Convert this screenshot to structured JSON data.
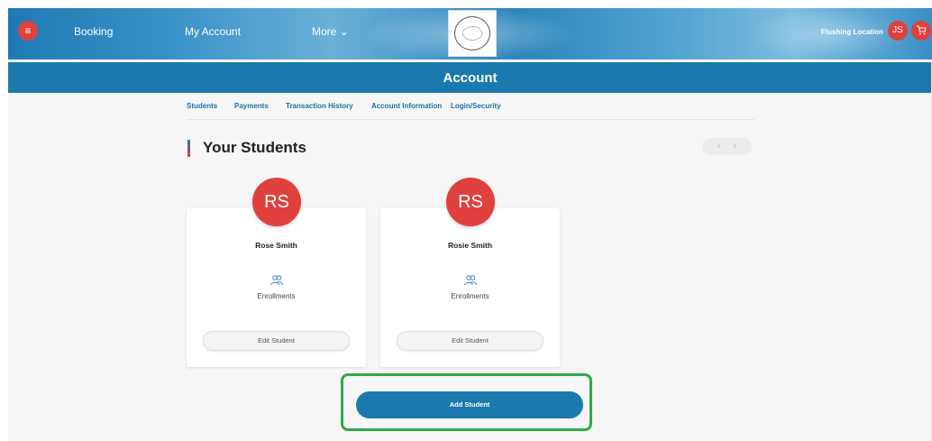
{
  "header": {
    "menu_icon": "hamburger-menu-icon",
    "nav": [
      {
        "label": "Booking"
      },
      {
        "label": "My Account"
      },
      {
        "label": "More ⌄"
      }
    ],
    "logo_icon": "dolphin-swimming-logo",
    "location": "Flushing Location",
    "user_initials": "JS",
    "cart_icon": "cart-icon",
    "brand_color": "#1b79ad",
    "accent_color": "#e0413f"
  },
  "page": {
    "title": "Account",
    "tabs": [
      {
        "label": "Students"
      },
      {
        "label": "Payments"
      },
      {
        "label": "Transaction History"
      },
      {
        "label": "Account Information"
      },
      {
        "label": "Login/Security"
      }
    ],
    "section_title": "Your Students",
    "pager_icons": [
      "chevron-left-icon",
      "chevron-right-icon"
    ]
  },
  "students": [
    {
      "initials": "RS",
      "name": "Rose Smith",
      "enrollments_label": "Enrollments",
      "edit_label": "Edit Student"
    },
    {
      "initials": "RS",
      "name": "Rosie Smith",
      "enrollments_label": "Enrollments",
      "edit_label": "Edit Student"
    }
  ],
  "actions": {
    "add_student": "Add Student",
    "highlight_color": "#2eaa4a"
  }
}
